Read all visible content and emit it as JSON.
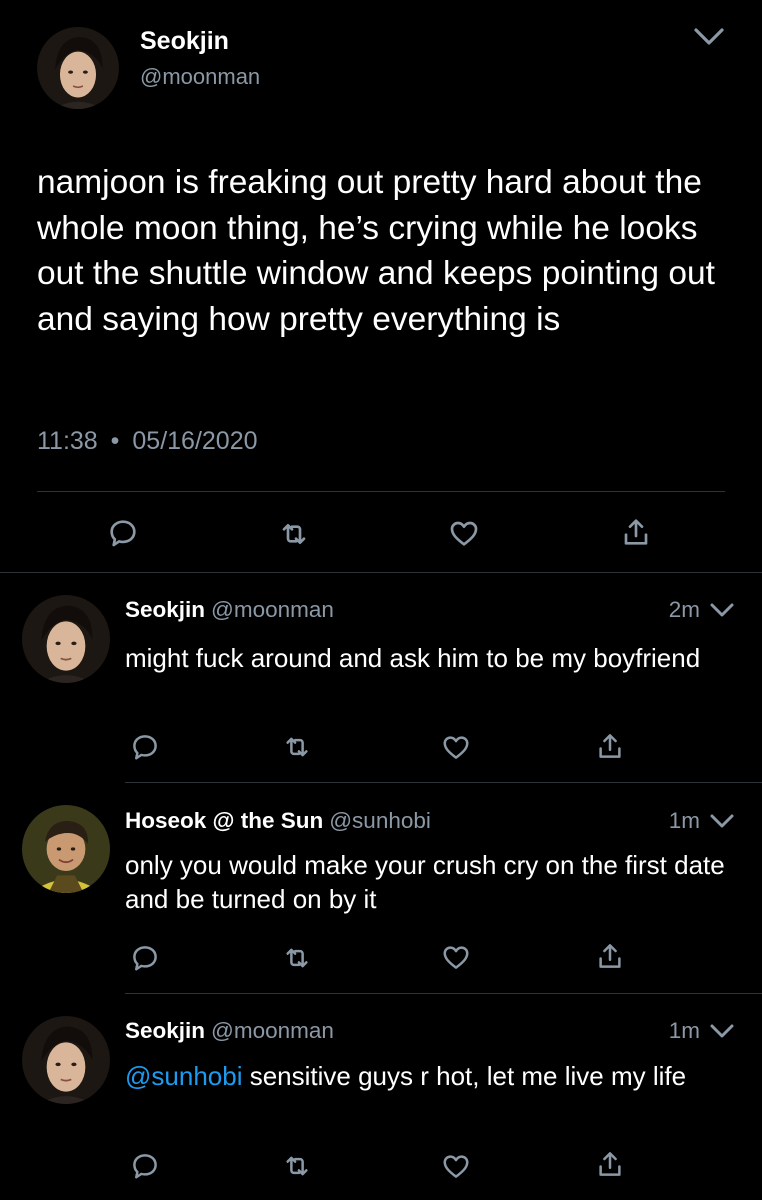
{
  "main_tweet": {
    "author_name": "Seokjin",
    "author_handle": "@moonman",
    "text": "namjoon is freaking out pretty hard about the whole moon thing, he’s crying while he looks out the shuttle window and keeps pointing out and saying how pretty everything is",
    "time": "11:38",
    "separator": "•",
    "date": "05/16/2020"
  },
  "replies": [
    {
      "author_name": "Seokjin",
      "author_handle": "@moonman",
      "time_ago": "2m",
      "mention": "",
      "text": "might fuck around and ask him to be my boyfriend"
    },
    {
      "author_name": "Hoseok @ the Sun",
      "author_handle": "@sunhobi",
      "time_ago": "1m",
      "mention": "",
      "text": "only you would make your crush cry on the first date and be turned on by it"
    },
    {
      "author_name": "Seokjin",
      "author_handle": "@moonman",
      "time_ago": "1m",
      "mention": "@sunhobi",
      "text": " sensitive guys r hot, let me live my life"
    }
  ],
  "icons": {
    "reply": "reply-icon",
    "retweet": "retweet-icon",
    "like": "heart-icon",
    "share": "share-icon",
    "more": "chevron-down-icon"
  },
  "colors": {
    "background": "#000000",
    "text": "#ffffff",
    "secondary_text": "#8b98a5",
    "link": "#1d9bf0",
    "divider": "#2f3336"
  }
}
